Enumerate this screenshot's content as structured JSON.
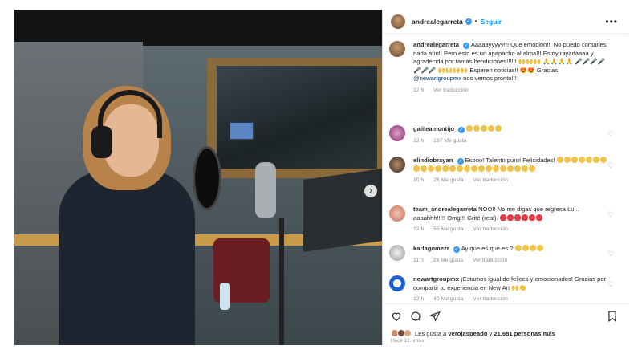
{
  "post": {
    "username": "andrealegarreta",
    "follow_label": "Seguir",
    "more_label": "•••",
    "next_label": "›"
  },
  "caption": {
    "username": "andrealegarreta",
    "text": "Aaaaayyyyy!!! Que emoción!!! No puedo contarles nada aún!! Pero esto es un apapacho al alma!!! Estoy rayadaaaa y agradecida por tantas bendiciones!!!!!! 🙌🙌🙌 🙏🙏🙏🙏 🎤🎤🎤🎤🎤🎤🎤 🙌🙌🙌🙌 Esperen noticias!! 😍😍 Gracias",
    "mention": "@newartgroupmx",
    "tail": "nos vemos pronto!!!",
    "time": "12 h",
    "translate": "Ver traducción"
  },
  "comments": [
    {
      "username": "galileamontijo",
      "verified": true,
      "text": "",
      "emoji_count": 5,
      "emoji_type": "clap",
      "time": "12 h",
      "likes": "197 Me gusta",
      "translate": ""
    },
    {
      "username": "elindiobrayan",
      "verified": true,
      "text": "Esooo! Talento puro! Felicidades!",
      "emoji_count": 24,
      "emoji_type": "clap",
      "time": "10 h",
      "likes": "26 Me gusta",
      "translate": "Ver traducción"
    },
    {
      "username": "team_andrealegarreta",
      "verified": false,
      "text": "NOO!! No me digas que regresa Lu... aaaahhh!!!!! Omg!!! Grité (real).",
      "emoji_count": 6,
      "emoji_type": "heart",
      "time": "12 h",
      "likes": "55 Me gusta",
      "translate": "Ver traducción"
    },
    {
      "username": "karlagomezr",
      "verified": true,
      "text": "Ay que es que es ?",
      "emoji_count": 4,
      "emoji_type": "clap",
      "time": "11 h",
      "likes": "28 Me gusta",
      "translate": "Ver traducción"
    },
    {
      "username": "newartgroupmx",
      "verified": false,
      "text": "¡Estamos igual de felices y emocionados! Gracias por compartir tu experiencia en New Art 🙌👏",
      "emoji_count": 0,
      "emoji_type": "",
      "time": "12 h",
      "likes": "40 Me gusta",
      "translate": "Ver traducción"
    }
  ],
  "likes": {
    "prefix": "Les gusta a",
    "user": "verojaspeado",
    "middle": "y",
    "count": "21.681 personas más"
  },
  "posted_ago": "Hace 12 horas"
}
